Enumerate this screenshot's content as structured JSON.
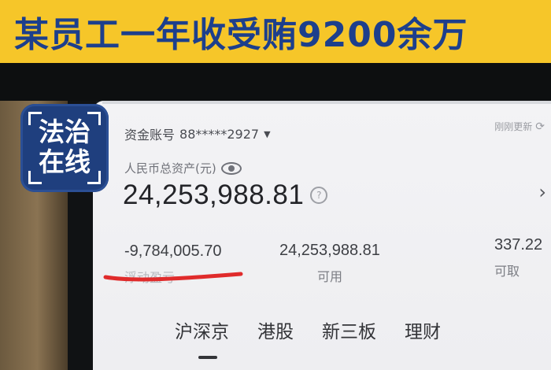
{
  "banner": {
    "headline": "某员工一年收受贿9200余万"
  },
  "logo": {
    "line1": "法治",
    "line2": "在线"
  },
  "account": {
    "label": "资金账号",
    "number": "88*****2927"
  },
  "refresh": {
    "label": "刚刚更新"
  },
  "assets": {
    "label": "人民币总资产(元)",
    "total": "24,253,988.81"
  },
  "stats": [
    {
      "value": "-9,784,005.70",
      "label": "浮动盈亏"
    },
    {
      "value": "24,253,988.81",
      "label": "可用"
    },
    {
      "value": "337.22",
      "label": "可取"
    }
  ],
  "tabs": [
    {
      "label": "沪深京"
    },
    {
      "label": "港股"
    },
    {
      "label": "新三板"
    },
    {
      "label": "理财"
    }
  ],
  "colors": {
    "banner_bg": "#f6c629",
    "banner_text": "#1d3f8c",
    "underline": "#e02b2b",
    "logo_bg": "#1f3f7e"
  }
}
